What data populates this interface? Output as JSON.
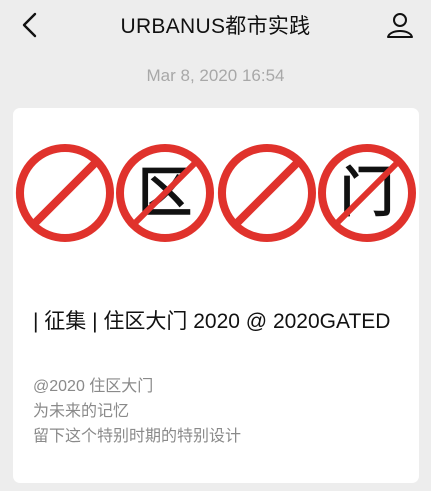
{
  "header": {
    "title": "URBANUS都市实践",
    "back_icon": "chevron-left-icon",
    "profile_icon": "person-icon"
  },
  "timestamp": "Mar 8, 2020 16:54",
  "card": {
    "banner": {
      "glyphs": [
        "区",
        "门"
      ],
      "accent_color": "#e0322c",
      "glyph_color": "#111111"
    },
    "title": "| 征集 | 住区大门 2020 @ 2020GATED",
    "description": [
      "@2020 住区大门",
      "为未来的记忆",
      "留下这个特别时期的特别设计"
    ]
  }
}
